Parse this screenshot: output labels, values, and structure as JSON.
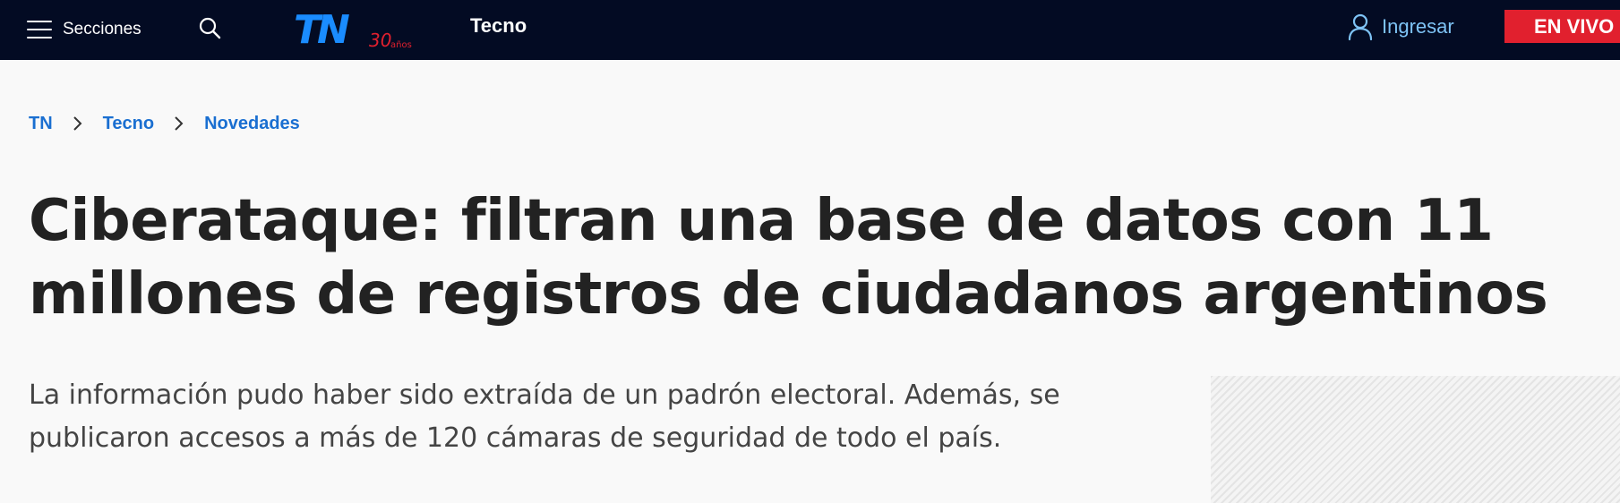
{
  "header": {
    "menu_label": "Secciones",
    "logo": {
      "brand": "TN",
      "anniversary": "30",
      "anniversary_suffix": "años",
      "brand_color": "#1a8cff",
      "anniversary_color": "#e1202e"
    },
    "section_label": "Tecno",
    "login_label": "Ingresar",
    "live_label": "EN VIVO",
    "icons": {
      "menu": "hamburger-icon",
      "search": "search-icon",
      "login": "user-icon"
    }
  },
  "breadcrumb": {
    "items": [
      "TN",
      "Tecno",
      "Novedades"
    ],
    "separator_icon": "chevron-right-icon"
  },
  "article": {
    "headline": "Ciberataque: filtran una base de datos con 11 millones de registros de ciudadanos argentinos",
    "subheadline": "La información pudo haber sido extraída de un padrón electoral. Además, se publicaron accesos a más de 120 cámaras de seguridad de todo el país."
  },
  "colors": {
    "header_bg": "#030b23",
    "accent_blue": "#1a6fd1",
    "login_blue": "#7ec3f5",
    "live_red": "#e1202e",
    "page_bg": "#f9f9f9",
    "headline_text": "#222222"
  }
}
